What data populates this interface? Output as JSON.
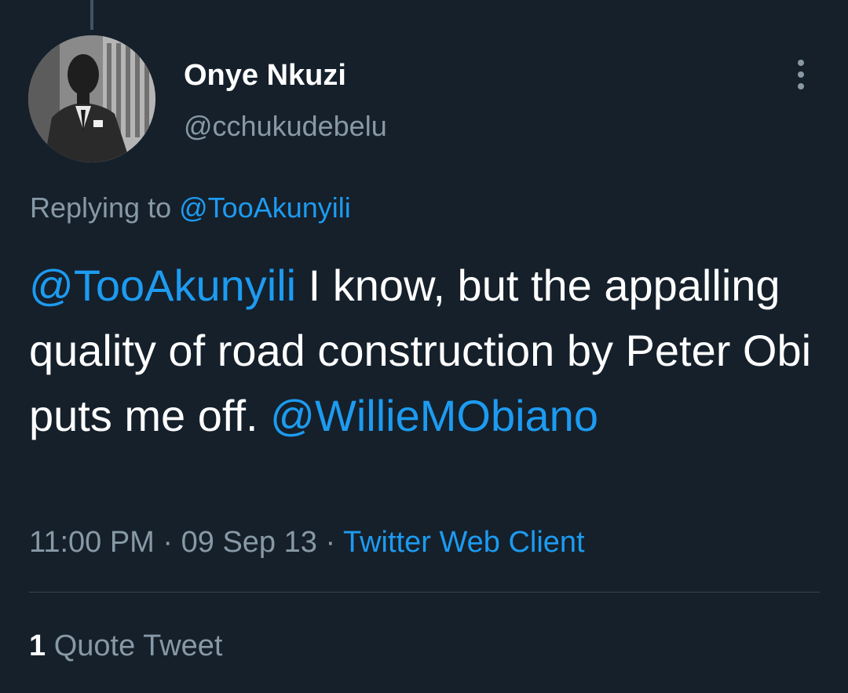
{
  "author": {
    "display_name": "Onye Nkuzi",
    "handle": "@cchukudebelu"
  },
  "reply": {
    "prefix": "Replying to",
    "to": "@TooAkunyili"
  },
  "tweet": {
    "mention_start": "@TooAkunyili",
    "text": " I know, but the appalling quality of road construction by Peter Obi puts me off. ",
    "mention_end": "@WillieMObiano"
  },
  "meta": {
    "time": "11:00 PM",
    "separator": " · ",
    "date": "09 Sep 13",
    "source": "Twitter Web Client"
  },
  "stats": {
    "quote_count": "1",
    "quote_label": "Quote Tweet"
  },
  "colors": {
    "background": "#15202b",
    "link": "#1d9bf0",
    "secondary_text": "#8899a6"
  }
}
